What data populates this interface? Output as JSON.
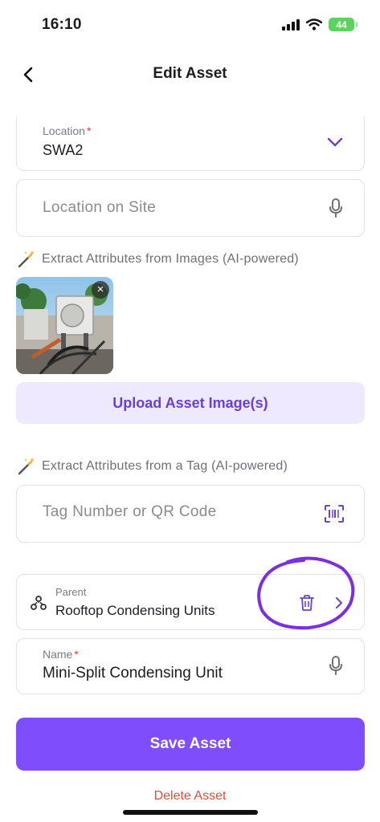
{
  "status_bar": {
    "time": "16:10",
    "battery_level": "44"
  },
  "header": {
    "title": "Edit Asset"
  },
  "location": {
    "label": "Location",
    "required_mark": "*",
    "value": "SWA2"
  },
  "location_on_site": {
    "placeholder": "Location on Site"
  },
  "image_ai": {
    "label": "Extract Attributes from Images (AI-powered)"
  },
  "images": {
    "remove_symbol": "×"
  },
  "upload": {
    "label": "Upload Asset Image(s)"
  },
  "tag_ai": {
    "label": "Extract Attributes from a Tag (AI-powered)"
  },
  "tag_input": {
    "placeholder": "Tag Number or QR Code"
  },
  "parent": {
    "label": "Parent",
    "value": "Rooftop Condensing Units"
  },
  "name": {
    "label": "Name",
    "required_mark": "*",
    "value": "Mini-Split Condensing Unit"
  },
  "actions": {
    "save_label": "Save Asset",
    "delete_label": "Delete Asset"
  },
  "colors": {
    "accent": "#7f4dfc",
    "accent_soft": "#efe9ff",
    "danger": "#e24b3b",
    "annotation": "#7a2fe0"
  },
  "icons": [
    "signal-icon",
    "wifi-icon",
    "battery-icon",
    "back-chevron-icon",
    "chevron-down-icon",
    "microphone-icon",
    "magic-wand-icon",
    "qr-scan-icon",
    "hierarchy-icon",
    "trash-icon",
    "chevron-right-icon",
    "close-icon"
  ]
}
